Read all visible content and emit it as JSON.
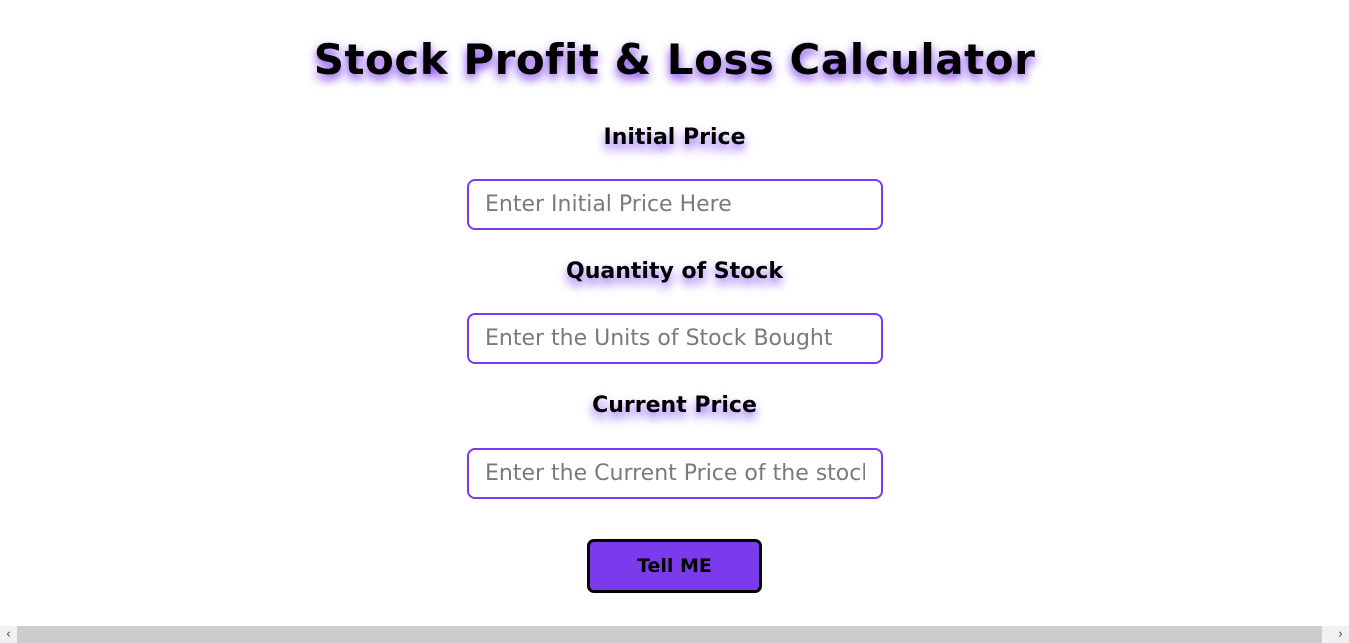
{
  "header": {
    "title": "Stock Profit & Loss Calculator"
  },
  "form": {
    "initial_price": {
      "label": "Initial Price",
      "placeholder": "Enter Initial Price Here",
      "value": ""
    },
    "quantity": {
      "label": "Quantity of Stock",
      "placeholder": "Enter the Units of Stock Bought",
      "value": ""
    },
    "current_price": {
      "label": "Current Price",
      "placeholder": "Enter the Current Price of the stock",
      "value": ""
    },
    "submit_label": "Tell ME"
  },
  "scrollbar": {
    "left_arrow_icon": "chevron-left-icon",
    "right_arrow_icon": "chevron-right-icon",
    "left_glyph": "‹",
    "right_glyph": "›"
  },
  "colors": {
    "accent": "#7c3aed",
    "text": "#000000",
    "background": "#ffffff"
  }
}
